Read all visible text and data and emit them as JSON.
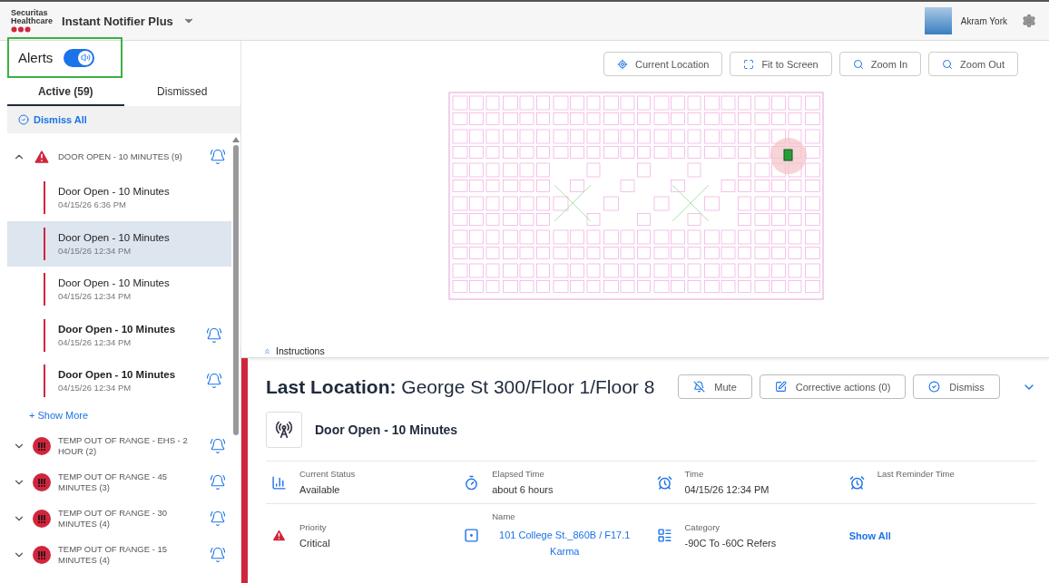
{
  "header": {
    "logo": {
      "line1": "Securitas",
      "line2": "Healthcare"
    },
    "app_title": "Instant Notifier Plus",
    "user": "Akram York"
  },
  "sidebar": {
    "alerts_toggle": {
      "label": "Alerts",
      "on": true
    },
    "tabs": [
      {
        "label": "Active (59)",
        "selected": true
      },
      {
        "label": "Dismissed",
        "selected": false
      }
    ],
    "dismiss_all": "Dismiss All",
    "groups": [
      {
        "title": "DOOR OPEN - 10 MINUTES (9)",
        "kind": "triangle",
        "expanded": true,
        "ringing": true,
        "show_more": "+ Show More",
        "items": [
          {
            "title": "Door Open - 10 Minutes",
            "time": "04/15/26 6:36 PM",
            "selected": false,
            "unread": false,
            "ringing": false
          },
          {
            "title": "Door Open - 10 Minutes",
            "time": "04/15/26 12:34 PM",
            "selected": true,
            "unread": false,
            "ringing": false
          },
          {
            "title": "Door Open - 10 Minutes",
            "time": "04/15/26 12:34 PM",
            "selected": false,
            "unread": false,
            "ringing": false
          },
          {
            "title": "Door Open - 10 Minutes",
            "time": "04/15/26 12:34 PM",
            "selected": false,
            "unread": true,
            "ringing": true
          },
          {
            "title": "Door Open - 10 Minutes",
            "time": "04/15/26 12:34 PM",
            "selected": false,
            "unread": true,
            "ringing": true
          }
        ]
      },
      {
        "title": "TEMP OUT OF RANGE - EHS - 2 HOUR (2)",
        "kind": "circle",
        "expanded": false,
        "ringing": true
      },
      {
        "title": "TEMP OUT OF RANGE - 45 MINUTES (3)",
        "kind": "circle",
        "expanded": false,
        "ringing": true
      },
      {
        "title": "TEMP OUT OF RANGE - 30 MINUTES (4)",
        "kind": "circle",
        "expanded": false,
        "ringing": true
      },
      {
        "title": "TEMP OUT OF RANGE - 15 MINUTES (4)",
        "kind": "circle",
        "expanded": false,
        "ringing": true
      }
    ]
  },
  "map": {
    "toolbar": [
      {
        "label": "Current Location"
      },
      {
        "label": "Fit to Screen"
      },
      {
        "label": "Zoom In"
      },
      {
        "label": "Zoom Out"
      }
    ]
  },
  "instructions": {
    "label": "Instructions"
  },
  "detail": {
    "heading_label": "Last Location:",
    "heading_value": "George St 300/Floor 1/Floor 8",
    "actions": [
      {
        "label": "Mute"
      },
      {
        "label": "Corrective actions (0)"
      },
      {
        "label": "Dismiss"
      }
    ],
    "alert_name": "Door Open - 10 Minutes",
    "rows": [
      [
        {
          "label": "Current Status",
          "value": "Available",
          "kind": "text"
        },
        {
          "label": "Elapsed Time",
          "value": "about 6 hours",
          "kind": "text"
        },
        {
          "label": "Time",
          "value": "04/15/26 12:34 PM",
          "kind": "text"
        },
        {
          "label": "Last Reminder Time",
          "kind": "text"
        }
      ],
      [
        {
          "label": "Priority",
          "value": "Critical",
          "kind": "text"
        },
        {
          "label": "Name",
          "value": "101 College St._860B / F17.1 Karma",
          "kind": "link"
        },
        {
          "label": "Category",
          "value": "-90C To -60C Refers",
          "kind": "text"
        },
        {
          "value": "Show All",
          "kind": "action"
        }
      ]
    ]
  }
}
